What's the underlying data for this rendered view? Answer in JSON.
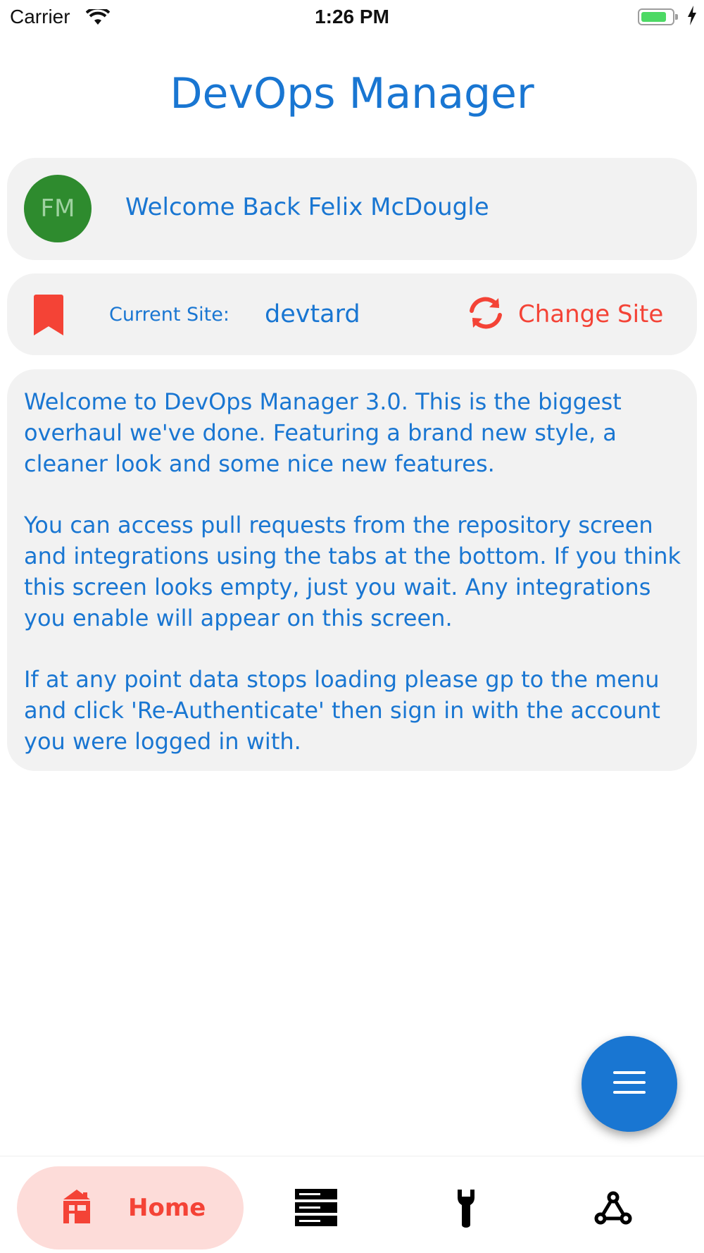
{
  "status_bar": {
    "carrier": "Carrier",
    "time": "1:26 PM",
    "battery_level": 0.85
  },
  "app": {
    "title": "DevOps Manager"
  },
  "welcome": {
    "initials": "FM",
    "message": "Welcome Back Felix McDougle"
  },
  "site": {
    "label": "Current Site:",
    "value": "devtard",
    "change_label": "Change Site"
  },
  "info": {
    "paragraphs": [
      "Welcome to DevOps Manager 3.0. This is the biggest overhaul we've done. Featuring a brand new style, a cleaner look and some nice new features.",
      "You can access pull requests from the repository screen and integrations using the tabs at the bottom. If you think this screen looks empty, just you wait. Any integrations you enable will appear on this screen.",
      "If at any point data stops loading please gp to the menu and click 'Re-Authenticate' then sign in with the account you were logged in with."
    ]
  },
  "bottom_nav": {
    "home_label": "Home",
    "items": [
      {
        "id": "home",
        "icon": "home-icon",
        "active": true
      },
      {
        "id": "repositories",
        "icon": "server-rack-icon",
        "active": false
      },
      {
        "id": "tools",
        "icon": "wrench-icon",
        "active": false
      },
      {
        "id": "integrations",
        "icon": "webhook-icon",
        "active": false
      }
    ]
  },
  "fab": {
    "icon": "menu-icon"
  },
  "colors": {
    "primary": "#1976d2",
    "accent": "#f44336",
    "card_bg": "#f2f2f2",
    "avatar_bg": "#2e8b2e",
    "nav_active_bg": "#fddcd9"
  }
}
